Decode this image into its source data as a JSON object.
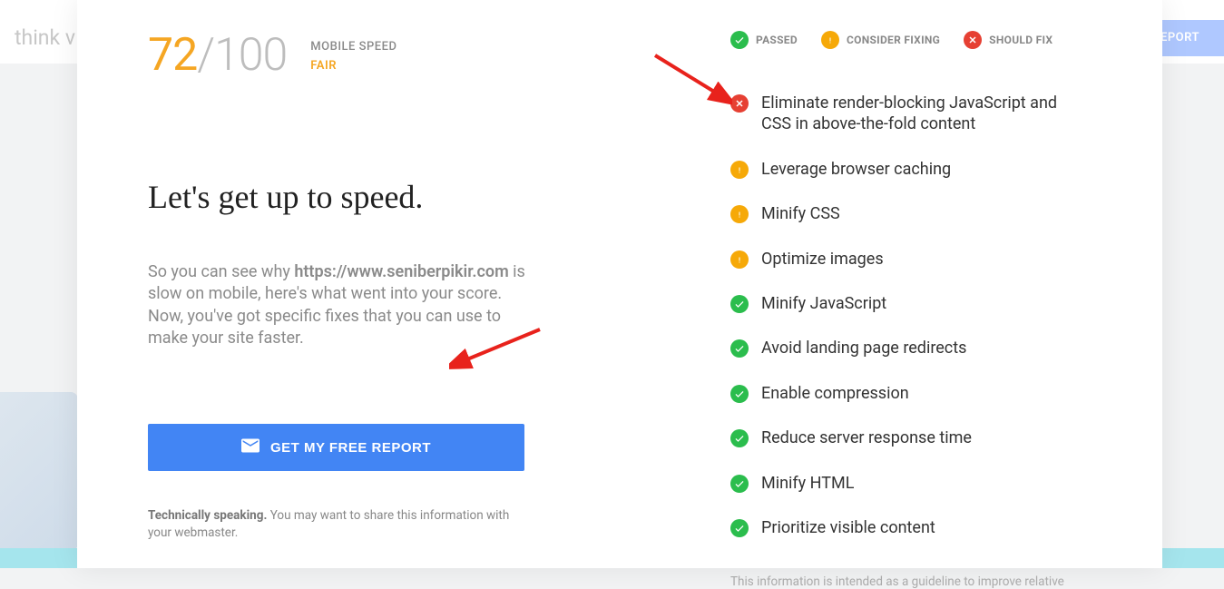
{
  "background": {
    "brand_fragment": "think v",
    "report_button": "EPORT"
  },
  "score": {
    "value": "72",
    "max": "/100",
    "label": "MOBILE SPEED",
    "rating": "FAIR"
  },
  "headline": "Let's get up to speed.",
  "description": {
    "prefix": "So you can see why ",
    "url": "https://www.seniberpikir.com",
    "suffix": " is slow on mobile, here's what went into your score. Now, you've got specific fixes that you can use to make your site faster."
  },
  "cta_label": "GET MY FREE REPORT",
  "technical": {
    "bold": "Technically speaking.",
    "text": " You may want to share this information with your webmaster."
  },
  "legend": {
    "passed": "PASSED",
    "consider": "CONSIDER FIXING",
    "fix": "SHOULD FIX"
  },
  "rules": [
    {
      "status": "fix",
      "text": "Eliminate render-blocking JavaScript and CSS in above-the-fold content"
    },
    {
      "status": "consider",
      "text": "Leverage browser caching"
    },
    {
      "status": "consider",
      "text": "Minify CSS"
    },
    {
      "status": "consider",
      "text": "Optimize images"
    },
    {
      "status": "passed",
      "text": "Minify JavaScript"
    },
    {
      "status": "passed",
      "text": "Avoid landing page redirects"
    },
    {
      "status": "passed",
      "text": "Enable compression"
    },
    {
      "status": "passed",
      "text": "Reduce server response time"
    },
    {
      "status": "passed",
      "text": "Minify HTML"
    },
    {
      "status": "passed",
      "text": "Prioritize visible content"
    }
  ],
  "disclaimer": "This information is intended as a guideline to improve relative"
}
